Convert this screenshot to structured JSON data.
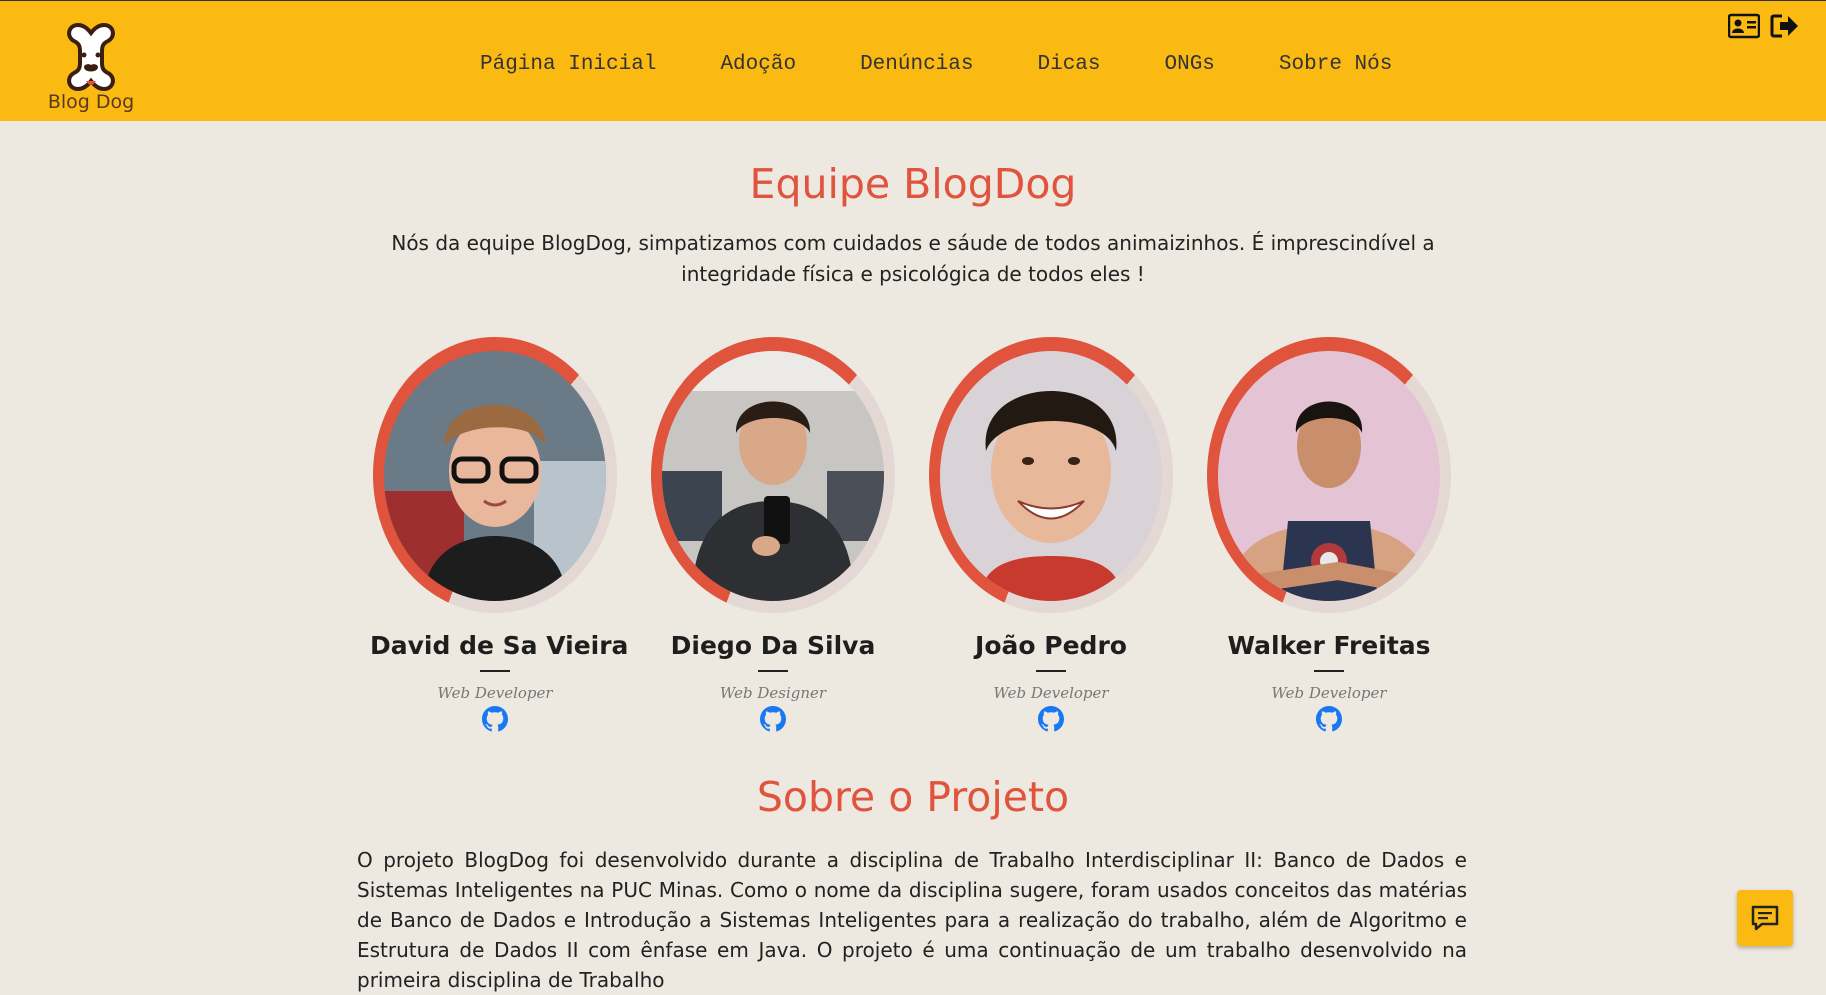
{
  "header": {
    "logo_text": "Blog Dog",
    "nav": [
      "Página Inicial",
      "Adoção",
      "Denúncias",
      "Dicas",
      "ONGs",
      "Sobre Nós"
    ],
    "icons": [
      "profile-card-icon",
      "logout-icon"
    ]
  },
  "team_section": {
    "title": "Equipe BlogDog",
    "intro": "Nós da equipe BlogDog, simpatizamos com cuidados e sáude de todos animaizinhos. É imprescindível a integridade física e psicológica de todos eles !",
    "members": [
      {
        "name": "David de Sa Vieira",
        "role": "Web Developer",
        "icon": "github-icon"
      },
      {
        "name": "Diego Da Silva",
        "role": "Web Designer",
        "icon": "github-icon"
      },
      {
        "name": "João Pedro",
        "role": "Web Developer",
        "icon": "github-icon"
      },
      {
        "name": "Walker Freitas",
        "role": "Web Developer",
        "icon": "github-icon"
      }
    ]
  },
  "project_section": {
    "title": "Sobre o Projeto",
    "text": "O projeto BlogDog foi desenvolvido durante a disciplina de Trabalho Interdisciplinar II: Banco de Dados e Sistemas Inteligentes na PUC Minas. Como o nome da disciplina sugere, foram usados conceitos das matérias de Banco de Dados e Introdução a Sistemas Inteligentes para a realização do trabalho, além de Algoritmo e Estrutura de Dados II com ênfase em Java. O projeto é uma continuação de um trabalho desenvolvido na primeira disciplina de Trabalho"
  },
  "chat_button": {
    "icon": "chat-icon"
  },
  "colors": {
    "header": "#fbba12",
    "accent": "#e0533d",
    "background": "#ede8e0",
    "github": "#1877f2"
  }
}
